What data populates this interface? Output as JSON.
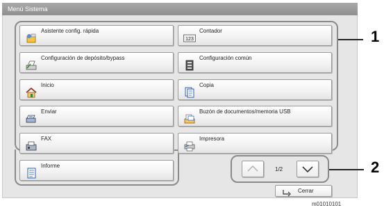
{
  "window": {
    "title": "Menú Sistema"
  },
  "menu": {
    "left": [
      {
        "label": "Asistente config. rápida",
        "icon": "wizard-icon"
      },
      {
        "label": "Configuración de depósito/bypass",
        "icon": "paper-tray-icon"
      },
      {
        "label": "Inicio",
        "icon": "home-icon"
      },
      {
        "label": "Enviar",
        "icon": "send-icon"
      },
      {
        "label": "FAX",
        "icon": "fax-icon"
      },
      {
        "label": "Informe",
        "icon": "report-icon"
      }
    ],
    "right": [
      {
        "label": "Contador",
        "icon": "counter-icon",
        "icon_text": "123"
      },
      {
        "label": "Configuración común",
        "icon": "common-settings-icon"
      },
      {
        "label": "Copia",
        "icon": "copy-icon"
      },
      {
        "label": "Buzón de documentos/memoria USB",
        "icon": "document-box-icon"
      },
      {
        "label": "Impresora",
        "icon": "printer-icon"
      }
    ]
  },
  "pagination": {
    "text": "1/2",
    "up_icon": "chevron-up-icon",
    "down_icon": "chevron-down-icon"
  },
  "close_button": {
    "label": "Cerrar",
    "icon": "return-arrow-icon"
  },
  "callouts": {
    "one": "1",
    "two": "2"
  },
  "figure_code": "m01010101"
}
